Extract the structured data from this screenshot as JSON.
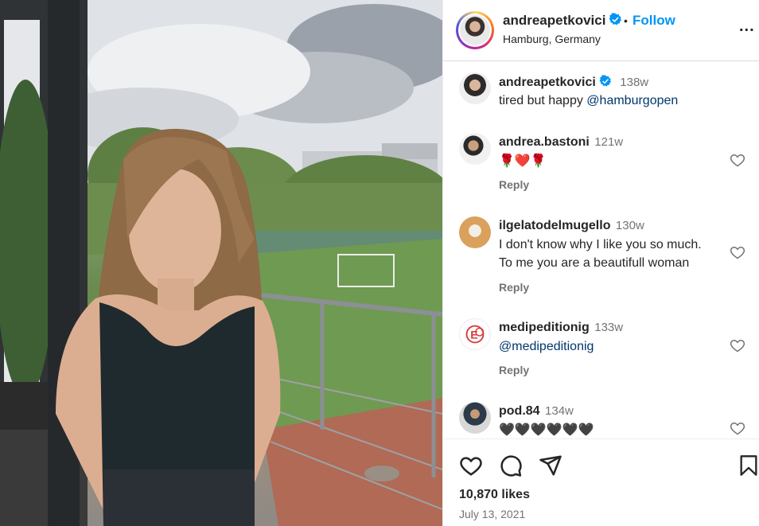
{
  "post": {
    "username": "andreapetkovici",
    "follow_label": "Follow",
    "separator": "•",
    "location": "Hamburg, Germany",
    "more_label": "..."
  },
  "caption": {
    "username": "andreapetkovici",
    "time": "138w",
    "text": "tired but happy ",
    "mention": "@hamburgopen"
  },
  "comments": [
    {
      "username": "andrea.bastoni",
      "time": "121w",
      "text": "🌹❤️🌹",
      "reply": "Reply"
    },
    {
      "username": "ilgelatodelmugello",
      "time": "130w",
      "line1": "I don't know why I like you so much.",
      "line2": "To me you are a beautifull woman",
      "reply": "Reply"
    },
    {
      "username": "medipeditionig",
      "time": "133w",
      "mention": "@medipeditionig",
      "reply": "Reply"
    },
    {
      "username": "pod.84",
      "time": "134w",
      "text": "🖤🖤🖤🖤🖤🖤"
    }
  ],
  "footer": {
    "likes": "10,870 likes",
    "date": "July 13, 2021"
  },
  "colors": {
    "accent": "#0095f6",
    "verified": "#0095f6",
    "text": "#262626",
    "muted": "#737373"
  },
  "icons": [
    "verified-badge-icon",
    "heart-icon",
    "comment-icon",
    "share-icon",
    "save-icon",
    "more-options-icon"
  ]
}
